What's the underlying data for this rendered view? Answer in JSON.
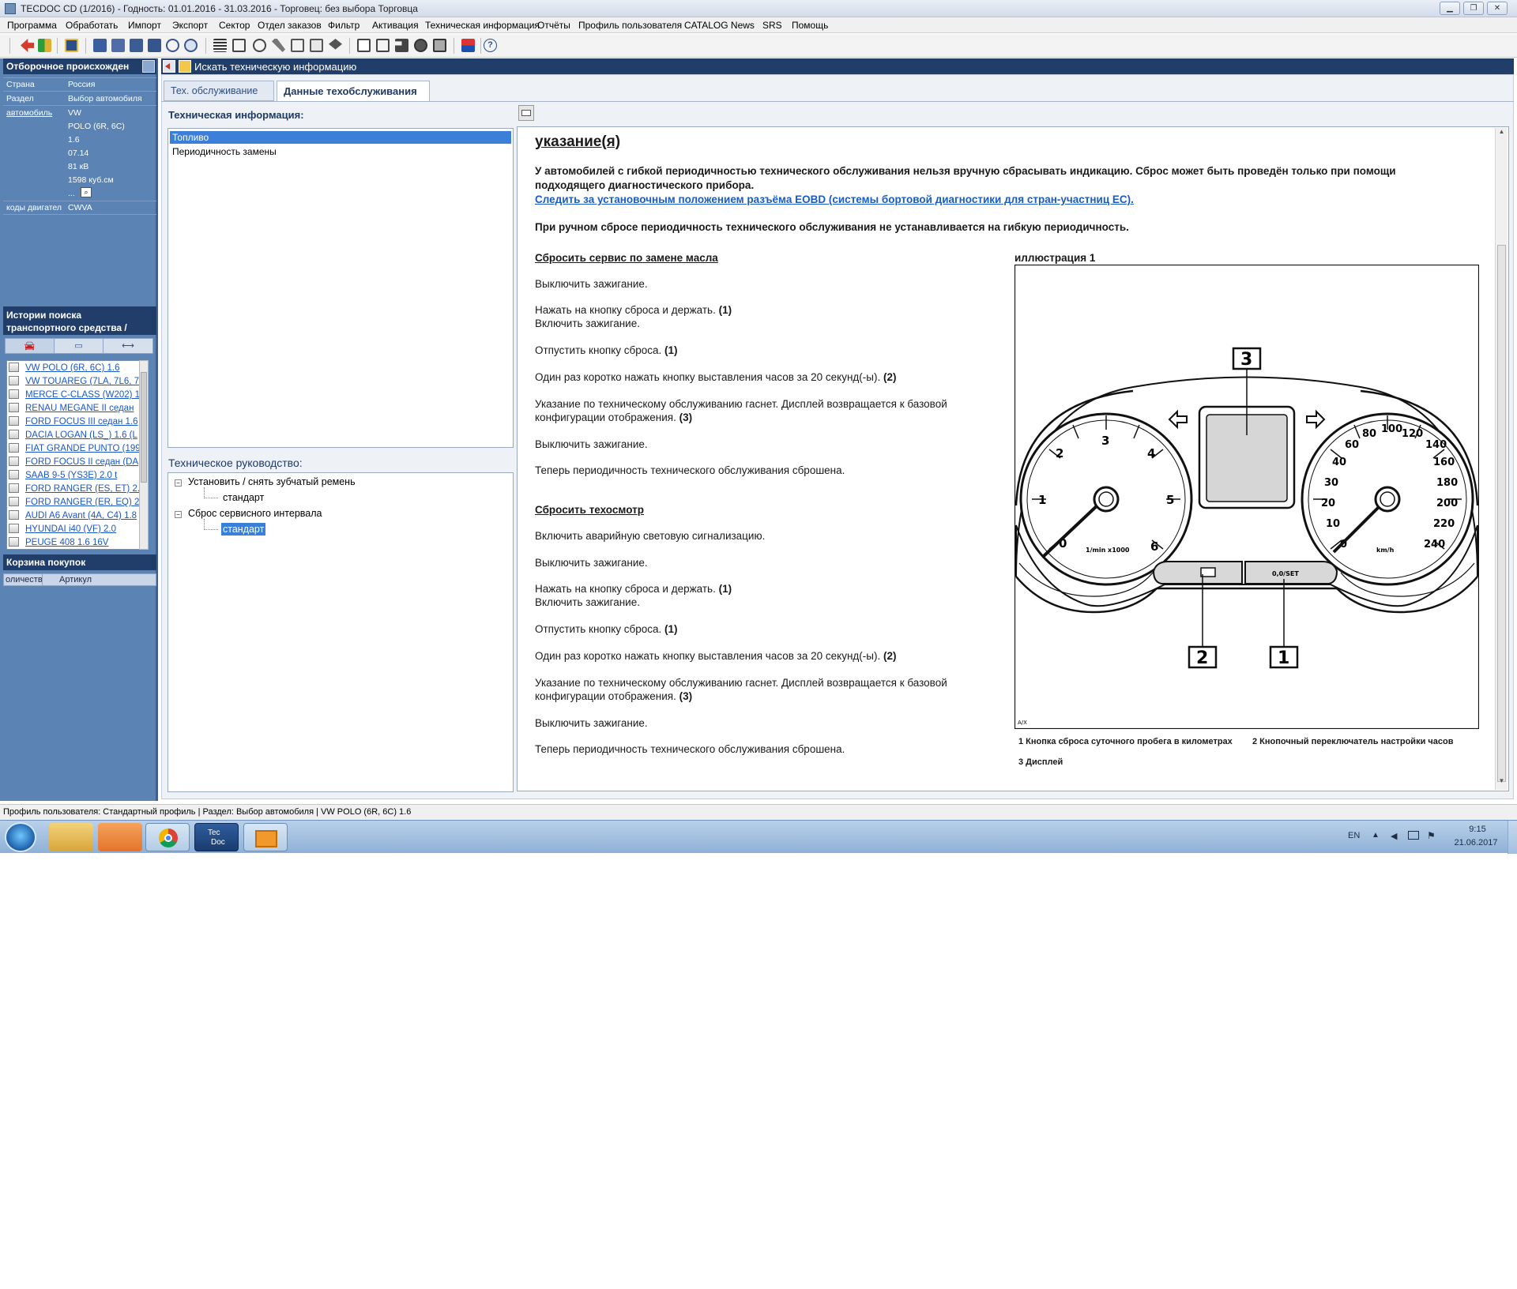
{
  "window": {
    "title": "TECDOC CD (1/2016)  -  Годность: 01.01.2016 - 31.03.2016  -  Торговец: без выбора Торговца"
  },
  "menu": [
    "Программа",
    "Обработать",
    "Импорт",
    "Экспорт",
    "Сектор",
    "Отдел заказов",
    "Фильтр",
    "Активация",
    "Техническая информация",
    "Отчёты",
    "Профиль пользователя",
    "CATALOG News",
    "SRS",
    "Помощь"
  ],
  "left": {
    "filter_title": "Отборочное происхожден",
    "filter_rows": [
      {
        "key": "Страна",
        "value": "Россия"
      },
      {
        "key": "Раздел",
        "value": "Выбор автомобиля"
      },
      {
        "key": "автомобиль",
        "value": "VW"
      }
    ],
    "vehicle_details": [
      "POLO (6R, 6C)",
      "1.6",
      "07.14",
      "81 кВ",
      "1598 куб.см",
      "..."
    ],
    "engine_codes_key": "коды двигател",
    "engine_codes_value": "CWVA",
    "history_title": "Истории поиска транспортного средства /",
    "history_items": [
      "VW POLO (6R, 6C) 1.6",
      "VW TOUAREG (7LA, 7L6, 7",
      "MERCE C-CLASS (W202) 1",
      "RENAU MEGANE II седан",
      "FORD FOCUS III седан 1.6",
      "DACIA LOGAN (LS_) 1.6 (L",
      "FIAT GRANDE PUNTO (199",
      "FORD FOCUS II седан (DA",
      "SAAB 9-5 (YS3E) 2.0 t",
      "FORD RANGER (ES, ET) 2.",
      "FORD RANGER (ER, EQ) 2",
      "AUDI A6 Avant (4A, C4) 1.8",
      "HYUNDAI i40 (VF) 2.0",
      "PEUGE 408 1.6 16V"
    ],
    "basket_title": "Корзина покупок",
    "basket_cols": [
      "оличеств",
      "Артикул"
    ]
  },
  "main": {
    "header": "Искать техническую информацию",
    "tabs": [
      "Тех. обслуживание",
      "Данные техобслуживания"
    ],
    "tech_info_title": "Техническая информация:",
    "tech_info_items": [
      "Топливо",
      "Периодичность замены"
    ],
    "tech_manual_title": "Техническое руководство:",
    "tree": {
      "node1": "Установить / снять зубчатый ремень",
      "node1_child": "стандарт",
      "node2": "Сброс сервисного интервала",
      "node2_child": "стандарт"
    }
  },
  "doc": {
    "heading": "указание(я)",
    "p1_line1": "У автомобилей с гибкой периодичностью технического обслуживания нельзя вручную сбрасывать индикацию. Сброс может быть проведён только при помощи",
    "p1_line2": "подходящего диагностического прибора.",
    "link": "Следить за установочным положением разъёма EOBD (системы бортовой диагностики для стран-участниц ЕС).",
    "p2": "При ручном сбросе периодичность технического обслуживания не устанавливается на гибкую периодичность.",
    "s1_title": "Сбросить сервис по замене масла",
    "s1": [
      "Выключить зажигание.",
      "Нажать на кнопку сброса и держать.",
      "Включить зажигание.",
      "Отпустить кнопку сброса.",
      "Один раз коротко нажать кнопку выставления часов за 20 секунд(-ы).",
      "Указание по техническому обслуживанию гаснет. Дисплей возвращается к базовой",
      "конфигурации отображения.",
      "Выключить зажигание.",
      "Теперь периодичность технического обслуживания сброшена."
    ],
    "s2_title": "Сбросить техосмотр",
    "s2": [
      "Включить аварийную световую сигнализацию.",
      "Выключить зажигание.",
      "Нажать на кнопку сброса и держать.",
      "Включить зажигание.",
      "Отпустить кнопку сброса.",
      "Один раз коротко нажать кнопку выставления часов за 20 секунд(-ы).",
      "Указание по техническому обслуживанию гаснет. Дисплей возвращается к базовой",
      "конфигурации отображения.",
      "Выключить зажигание.",
      "Теперь периодичность технического обслуживания сброшена."
    ],
    "ref1": "(1)",
    "ref2": "(2)",
    "ref3": "(3)",
    "illus_title": "иллюстрация 1",
    "illus": {
      "callouts": [
        "3",
        "2",
        "1"
      ],
      "rpm_ticks": [
        "1",
        "2",
        "3",
        "4",
        "5",
        "6",
        "0"
      ],
      "rpm_unit": "1/min x1000",
      "speed_ticks": [
        "0",
        "10",
        "20",
        "30",
        "40",
        "60",
        "80",
        "100",
        "120",
        "140",
        "160",
        "180",
        "200",
        "220",
        "240"
      ],
      "speed_unit": "km/h",
      "button_label": "0,0/SET",
      "corner_mark": "A/X"
    },
    "legend1": "1 Кнопка сброса суточного пробега в километрах",
    "legend2": "2 Кнопочный переключатель настройки часов",
    "legend3": "3 Дисплей"
  },
  "status": "Профиль пользователя: Стандартный профиль | Раздел: Выбор автомобиля | VW POLO (6R, 6C) 1.6",
  "taskbar": {
    "lang": "EN",
    "time": "9:15",
    "date": "21.06.2017",
    "tecdoc_label_1": "Tec",
    "tecdoc_label_2": "Doc"
  }
}
